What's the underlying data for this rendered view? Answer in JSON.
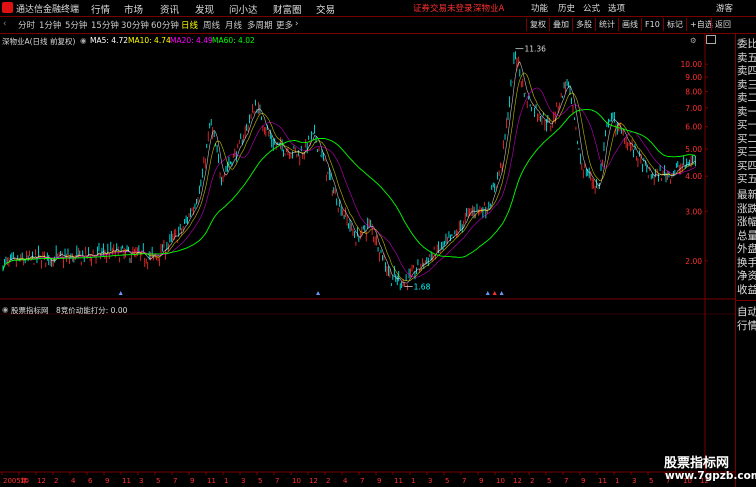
{
  "menubar": {
    "app_name": "通达信金融终端",
    "items": [
      "行情",
      "市场",
      "资讯",
      "发现",
      "问小达",
      "财富圈",
      "交易"
    ],
    "status": "证券交易未登录",
    "stock": "深物业A",
    "right_items": [
      "功能",
      "历史",
      "公式",
      "选项",
      "游客"
    ]
  },
  "periodbar": {
    "periods": [
      "分时",
      "1分钟",
      "5分钟",
      "15分钟",
      "30分钟",
      "60分钟",
      "日线",
      "周线",
      "月线",
      "多周期",
      "更多"
    ],
    "active": "日线",
    "more_arrow": "›",
    "tools": [
      "复权",
      "叠加",
      "多股",
      "统计",
      "画线",
      "F10",
      "标记",
      "+自选",
      "返回"
    ]
  },
  "main_chart": {
    "title": "深物业A(日线 前复权)",
    "ma": [
      {
        "label": "MA5: 4.72",
        "color": "#ffffff"
      },
      {
        "label": "MA10: 4.74",
        "color": "#ffff00"
      },
      {
        "label": "MA20: 4.49",
        "color": "#ff00ff"
      },
      {
        "label": "MA60: 4.02",
        "color": "#00ff00"
      }
    ],
    "high_label": "11.36",
    "low_label": "1.68",
    "y_ticks": [
      "10.00",
      "9.00",
      "8.00",
      "7.00",
      "6.00",
      "5.00",
      "4.00",
      "3.00",
      "2.00"
    ],
    "y_axis_scale": "log"
  },
  "indicator": {
    "name": "股票指标网",
    "formula": "8竞价动能打分: 0.00"
  },
  "x_axis": {
    "labels": [
      "2005年",
      "10",
      "12",
      "2",
      "4",
      "6",
      "9",
      "11",
      "3",
      "5",
      "7",
      "9",
      "11",
      "1",
      "3",
      "5",
      "7",
      "10",
      "12",
      "2",
      "4",
      "7",
      "9",
      "11",
      "1",
      "3",
      "5",
      "7",
      "9",
      "10",
      "12",
      "2",
      "5",
      "7",
      "9",
      "11",
      "1",
      "3",
      "5",
      "7",
      "10",
      "12"
    ]
  },
  "right_panel": {
    "items": [
      "委比",
      "卖五",
      "卖四",
      "卖三",
      "卖二",
      "卖一",
      "买一",
      "买二",
      "买三",
      "买四",
      "买五",
      "最新",
      "涨跌",
      "涨幅",
      "总量",
      "外盘",
      "换手",
      "净资",
      "收益"
    ],
    "bottom_items": [
      "自动",
      "行情"
    ]
  },
  "watermark": {
    "title": "股票指标网",
    "url": "www.7gpzb.com"
  },
  "colors": {
    "border": "#7a0000",
    "rise": "#ff3030",
    "fall": "#00ffff",
    "ma60": "#00ff00"
  }
}
